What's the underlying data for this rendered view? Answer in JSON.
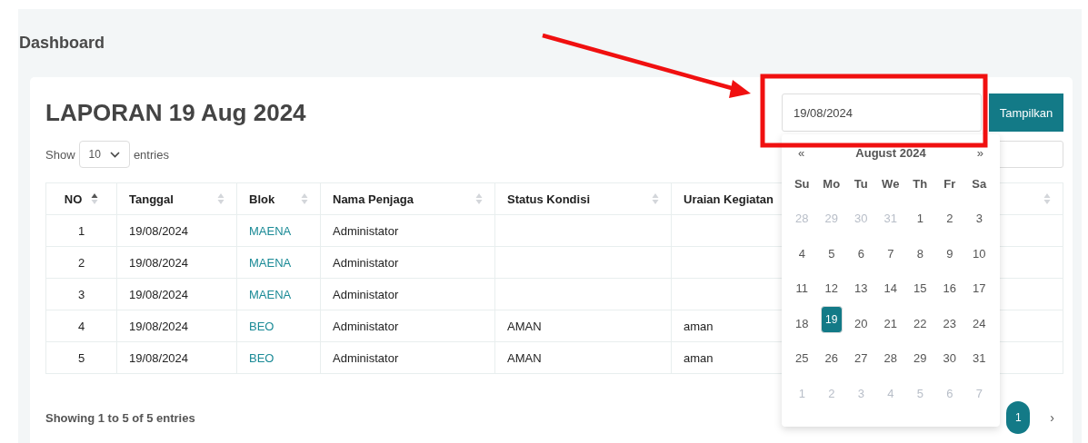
{
  "page": {
    "title": "Dashboard"
  },
  "report": {
    "title": "LAPORAN 19 Aug 2024",
    "date_field": {
      "value": "19/08/2024"
    },
    "submit_button": "Tampilkan",
    "length_menu": {
      "label_before": "Show",
      "value": "10",
      "label_after": "entries"
    },
    "table": {
      "columns": [
        {
          "label": "NO",
          "sorted": true
        },
        {
          "label": "Tanggal",
          "sorted": false
        },
        {
          "label": "Blok",
          "sorted": false
        },
        {
          "label": "Nama Penjaga",
          "sorted": false
        },
        {
          "label": "Status Kondisi",
          "sorted": false
        },
        {
          "label": "Uraian Kegiatan"
        },
        {
          "sorted": false
        }
      ],
      "rows": [
        {
          "no": "1",
          "tanggal": "19/08/2024",
          "blok": "MAENA",
          "nama_penjaga": "Administator"
        },
        {
          "no": "2",
          "tanggal": "19/08/2024",
          "blok": "MAENA",
          "nama_penjaga": "Administator"
        },
        {
          "no": "3",
          "tanggal": "19/08/2024",
          "blok": "MAENA",
          "nama_penjaga": "Administator"
        },
        {
          "no": "4",
          "tanggal": "19/08/2024",
          "blok": "BEO",
          "nama_penjaga": "Administator",
          "status_kondisi": "AMAN",
          "uraian_kegiatan": "aman"
        },
        {
          "no": "5",
          "tanggal": "19/08/2024",
          "blok": "BEO",
          "nama_penjaga": "Administator",
          "status_kondisi": "AMAN",
          "uraian_kegiatan": "aman"
        }
      ]
    },
    "info": "Showing 1 to 5 of 5 entries",
    "pagination": {
      "pages": [
        {
          "label": "1",
          "selected": true
        }
      ],
      "next": "›"
    }
  },
  "datepicker": {
    "prev": "«",
    "month": "August 2024",
    "next": "»",
    "weekdays": [
      "Su",
      "Mo",
      "Tu",
      "We",
      "Th",
      "Fr",
      "Sa"
    ],
    "weeks": [
      [
        {
          "day": "28",
          "muted": true,
          "selected": false
        },
        {
          "day": "29",
          "muted": true,
          "selected": false
        },
        {
          "day": "30",
          "muted": true,
          "selected": false
        },
        {
          "day": "31",
          "muted": true,
          "selected": false
        },
        {
          "day": "1",
          "muted": false,
          "selected": false
        },
        {
          "day": "2",
          "muted": false,
          "selected": false
        },
        {
          "day": "3",
          "muted": false,
          "selected": false
        }
      ],
      [
        {
          "day": "4",
          "muted": false,
          "selected": false
        },
        {
          "day": "5",
          "muted": false,
          "selected": false
        },
        {
          "day": "6",
          "muted": false,
          "selected": false
        },
        {
          "day": "7",
          "muted": false,
          "selected": false
        },
        {
          "day": "8",
          "muted": false,
          "selected": false
        },
        {
          "day": "9",
          "muted": false,
          "selected": false
        },
        {
          "day": "10",
          "muted": false,
          "selected": false
        }
      ],
      [
        {
          "day": "11",
          "muted": false,
          "selected": false
        },
        {
          "day": "12",
          "muted": false,
          "selected": false
        },
        {
          "day": "13",
          "muted": false,
          "selected": false
        },
        {
          "day": "14",
          "muted": false,
          "selected": false
        },
        {
          "day": "15",
          "muted": false,
          "selected": false
        },
        {
          "day": "16",
          "muted": false,
          "selected": false
        },
        {
          "day": "17",
          "muted": false,
          "selected": false
        }
      ],
      [
        {
          "day": "18",
          "muted": false,
          "selected": false
        },
        {
          "day": "19",
          "muted": false,
          "selected": true
        },
        {
          "day": "20",
          "muted": false,
          "selected": false
        },
        {
          "day": "21",
          "muted": false,
          "selected": false
        },
        {
          "day": "22",
          "muted": false,
          "selected": false
        },
        {
          "day": "23",
          "muted": false,
          "selected": false
        },
        {
          "day": "24",
          "muted": false,
          "selected": false
        }
      ],
      [
        {
          "day": "25",
          "muted": false,
          "selected": false
        },
        {
          "day": "26",
          "muted": false,
          "selected": false
        },
        {
          "day": "27",
          "muted": false,
          "selected": false
        },
        {
          "day": "28",
          "muted": false,
          "selected": false
        },
        {
          "day": "29",
          "muted": false,
          "selected": false
        },
        {
          "day": "30",
          "muted": false,
          "selected": false
        },
        {
          "day": "31",
          "muted": false,
          "selected": false
        }
      ],
      [
        {
          "day": "1",
          "muted": true,
          "selected": false
        },
        {
          "day": "2",
          "muted": true,
          "selected": false
        },
        {
          "day": "3",
          "muted": true,
          "selected": false
        },
        {
          "day": "4",
          "muted": true,
          "selected": false
        },
        {
          "day": "5",
          "muted": true,
          "selected": false
        },
        {
          "day": "6",
          "muted": true,
          "selected": false
        },
        {
          "day": "7",
          "muted": true,
          "selected": false
        }
      ]
    ]
  }
}
